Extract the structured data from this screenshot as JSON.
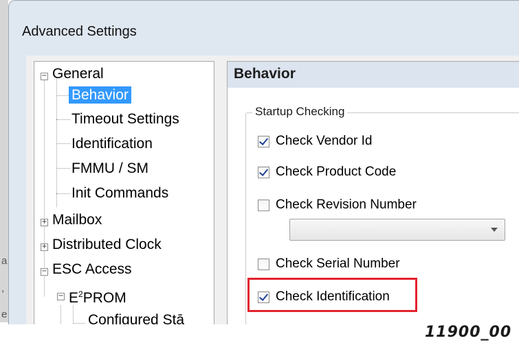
{
  "window": {
    "title": "Advanced Settings"
  },
  "tree": {
    "general": "General",
    "behavior": "Behavior",
    "timeout_settings": "Timeout Settings",
    "identification": "Identification",
    "fmmu_sm": "FMMU / SM",
    "init_commands": "Init Commands",
    "mailbox": "Mailbox",
    "distributed_clock": "Distributed Clock",
    "esc_access": "ESC Access",
    "eeprom_prefix": "E",
    "eeprom_sup": "2",
    "eeprom_suffix": "PROM",
    "configured_station": "Configured Stā",
    "selected": "Behavior"
  },
  "panel": {
    "header": "Behavior",
    "group_title": "Startup Checking",
    "checkboxes": [
      {
        "label": "Check Vendor Id",
        "checked": true
      },
      {
        "label": "Check Product Code",
        "checked": true
      },
      {
        "label": "Check Revision Number",
        "checked": false
      },
      {
        "label": "Check Serial Number",
        "checked": false
      },
      {
        "label": "Check Identification",
        "checked": true
      }
    ],
    "revision_dropdown_value": ""
  },
  "highlight_color": "#e3222d",
  "caption": "11900_00",
  "icons": [
    "expand-minus-icon",
    "expand-plus-icon",
    "checkmark-icon",
    "dropdown-arrow-icon"
  ]
}
